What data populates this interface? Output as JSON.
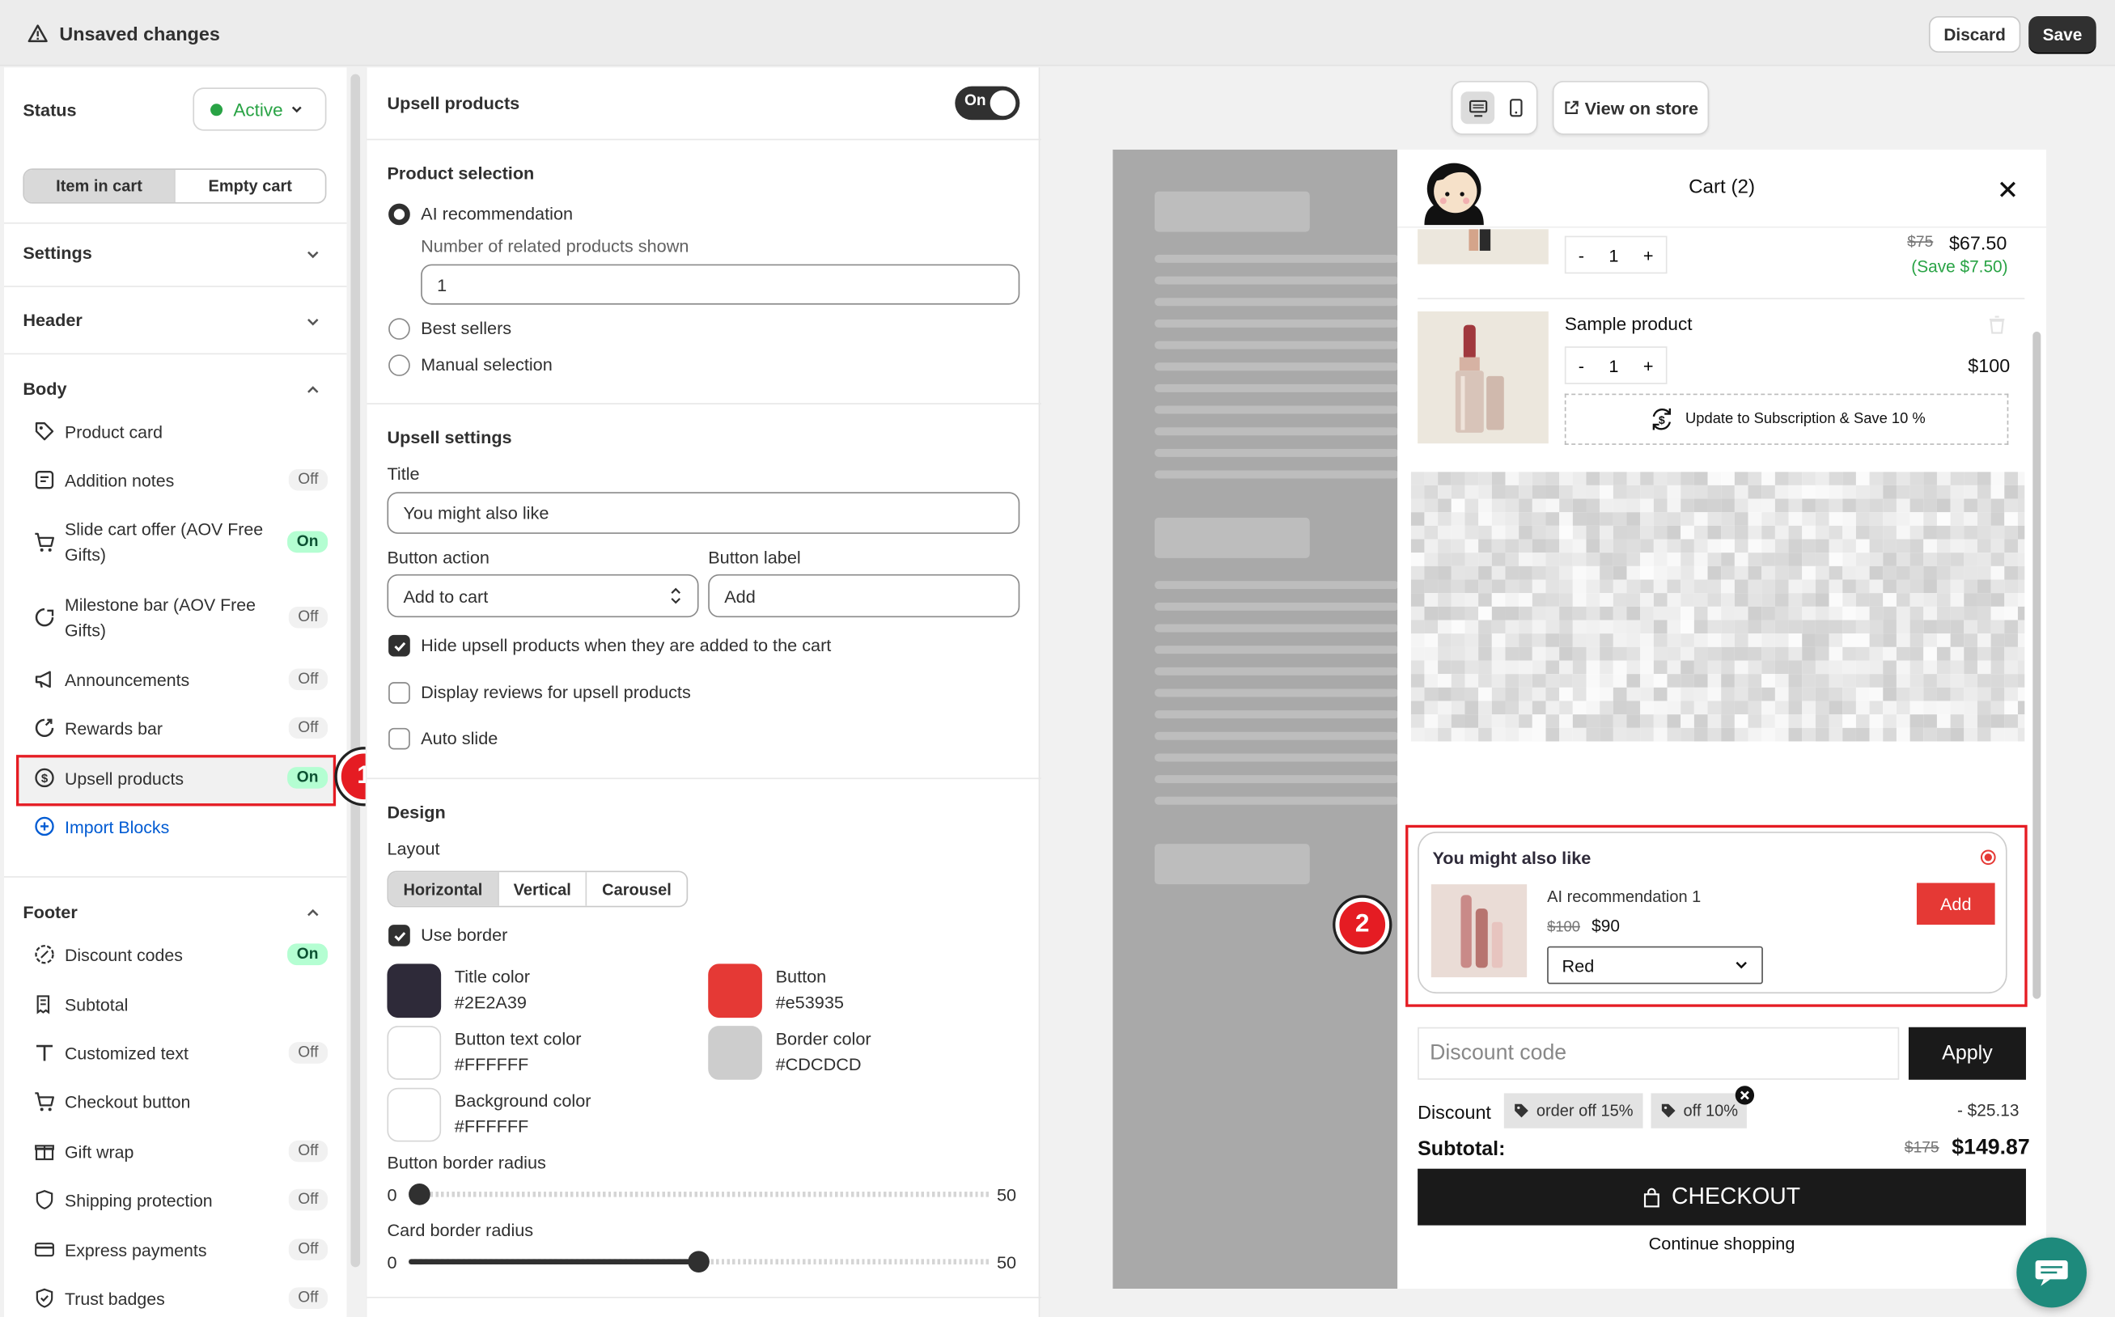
{
  "topbar": {
    "title": "Unsaved changes",
    "discard": "Discard",
    "save": "Save"
  },
  "left": {
    "status_label": "Status",
    "status_value": "Active",
    "seg": [
      "Item in cart",
      "Empty cart"
    ],
    "settings": "Settings",
    "header": "Header",
    "body": "Body",
    "body_items": [
      {
        "label": "Product card",
        "state": ""
      },
      {
        "label": "Addition notes",
        "state": "Off"
      },
      {
        "label": "Slide cart offer (AOV Free Gifts)",
        "state": "On"
      },
      {
        "label": "Milestone bar (AOV Free Gifts)",
        "state": "Off"
      },
      {
        "label": "Announcements",
        "state": "Off"
      },
      {
        "label": "Rewards bar",
        "state": "Off"
      },
      {
        "label": "Upsell products",
        "state": "On"
      }
    ],
    "import_blocks": "Import Blocks",
    "footer": "Footer",
    "footer_items": [
      {
        "label": "Discount codes",
        "state": "On"
      },
      {
        "label": "Subtotal",
        "state": ""
      },
      {
        "label": "Customized text",
        "state": "Off"
      },
      {
        "label": "Checkout button",
        "state": ""
      },
      {
        "label": "Gift wrap",
        "state": "Off"
      },
      {
        "label": "Shipping protection",
        "state": "Off"
      },
      {
        "label": "Express payments",
        "state": "Off"
      },
      {
        "label": "Trust badges",
        "state": "Off"
      }
    ]
  },
  "mid": {
    "title": "Upsell products",
    "toggle": "On",
    "product_selection": "Product selection",
    "ai": "AI recommendation",
    "num_label": "Number of related products shown",
    "num_value": "1",
    "best": "Best sellers",
    "manual": "Manual selection",
    "upsell_settings": "Upsell settings",
    "title_label": "Title",
    "title_value": "You might also like",
    "btn_action_label": "Button action",
    "btn_action_value": "Add to cart",
    "btn_label_label": "Button label",
    "btn_label_value": "Add",
    "hide": "Hide upsell products when they are added to the cart",
    "reviews": "Display reviews for upsell products",
    "autoslide": "Auto slide",
    "design": "Design",
    "layout": "Layout",
    "layouts": [
      "Horizontal",
      "Vertical",
      "Carousel"
    ],
    "use_border": "Use border",
    "colors": [
      {
        "name": "Title color",
        "hex": "#2E2A39"
      },
      {
        "name": "Button",
        "hex": "#e53935"
      },
      {
        "name": "Button text color",
        "hex": "#FFFFFF"
      },
      {
        "name": "Border color",
        "hex": "#CDCDCD"
      },
      {
        "name": "Background color",
        "hex": "#FFFFFF"
      }
    ],
    "btn_radius_label": "Button border radius",
    "card_radius_label": "Card border radius",
    "min": "0",
    "max": "50",
    "btn_radius_value": 0,
    "card_radius_value": 25
  },
  "preview": {
    "view_store": "View on store",
    "cart_title": "Cart (2)",
    "item1": {
      "qty": "1",
      "old": "$75",
      "price": "$67.50",
      "save": "(Save $7.50)"
    },
    "item2": {
      "name": "Sample product",
      "qty": "1",
      "price": "$100",
      "sub": "Update to Subscription & Save 10 %"
    },
    "upsell": {
      "title": "You might also like",
      "product": "AI recommendation 1",
      "old": "$100",
      "price": "$90",
      "variant": "Red",
      "add": "Add"
    },
    "discount_placeholder": "Discount code",
    "apply": "Apply",
    "discount_label": "Discount",
    "tags": [
      "order off 15%",
      "off 10%"
    ],
    "discount_amount": "- $25.13",
    "subtotal_label": "Subtotal:",
    "subtotal_old": "$175",
    "subtotal": "$149.87",
    "checkout": "CHECKOUT",
    "continue": "Continue shopping"
  },
  "badges": [
    "1",
    "2"
  ]
}
